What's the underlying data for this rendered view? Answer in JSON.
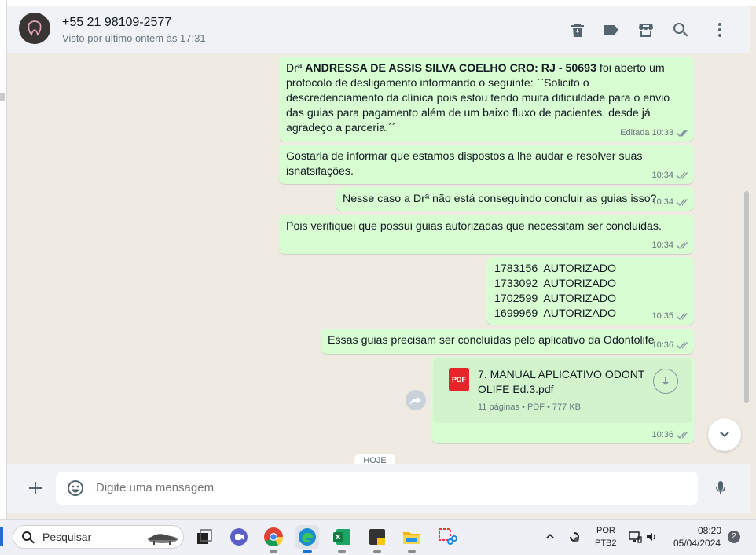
{
  "header": {
    "contact_name": "+55 21 98109-2577",
    "last_seen": "Visto por último ontem às 17:31",
    "icons": [
      "delete-icon",
      "label-icon",
      "catalog-icon",
      "search-icon",
      "menu-icon"
    ]
  },
  "messages": [
    {
      "id": "m1",
      "prefix": "Drª ",
      "bold": "ANDRESSA DE ASSIS SILVA COELHO CRO: RJ - 50693",
      "text": " foi aberto um protocolo de desligamento informando o seguinte: ``Solicito o descredenciamento da clínica pois estou tendo muita dificuldade para o envio das guias para pagamento além de um baixo fluxo de pacientes. desde já agradeço a parceria.´´",
      "edited": "Editada",
      "time": "10:33"
    },
    {
      "id": "m2",
      "text": "Gostaria de informar que estamos dispostos a lhe audar e resolver suas isnatsifações.",
      "time": "10:34"
    },
    {
      "id": "m3",
      "text": "Nesse caso a Drª não está conseguindo concluir as guias isso?",
      "time": "10:34"
    },
    {
      "id": "m4",
      "text": "Pois verifiquei que possui guias autorizadas que necessitam ser concluidas.",
      "time": "10:34"
    },
    {
      "id": "m5",
      "lines": [
        "1783156  AUTORIZADO",
        "1733092  AUTORIZADO",
        "1702599  AUTORIZADO",
        "1699969  AUTORIZADO"
      ],
      "time": "10:35"
    },
    {
      "id": "m6",
      "text": "Essas guias precisam ser concluídas pelo aplicativo da Odontolife",
      "time": "10:36"
    },
    {
      "id": "m7",
      "document": {
        "type_badge": "PDF",
        "title": "7. MANUAL APLICATIVO ODONT OLIFE Ed.3.pdf",
        "info": "11 páginas • PDF • 777 KB"
      },
      "time": "10:36"
    }
  ],
  "date_chip": "HOJE",
  "composer": {
    "placeholder": "Digite uma mensagem"
  },
  "taskbar": {
    "search_label": "Pesquisar",
    "lang_line1": "POR",
    "lang_line2": "PTB2",
    "time": "08:20",
    "date": "05/04/2024",
    "notification_count": "2"
  },
  "colors": {
    "outgoing_bubble": "#d9fdd3",
    "chat_background": "#efeae2",
    "header_background": "#f0f2f5",
    "pdf_red": "#e5252a"
  }
}
